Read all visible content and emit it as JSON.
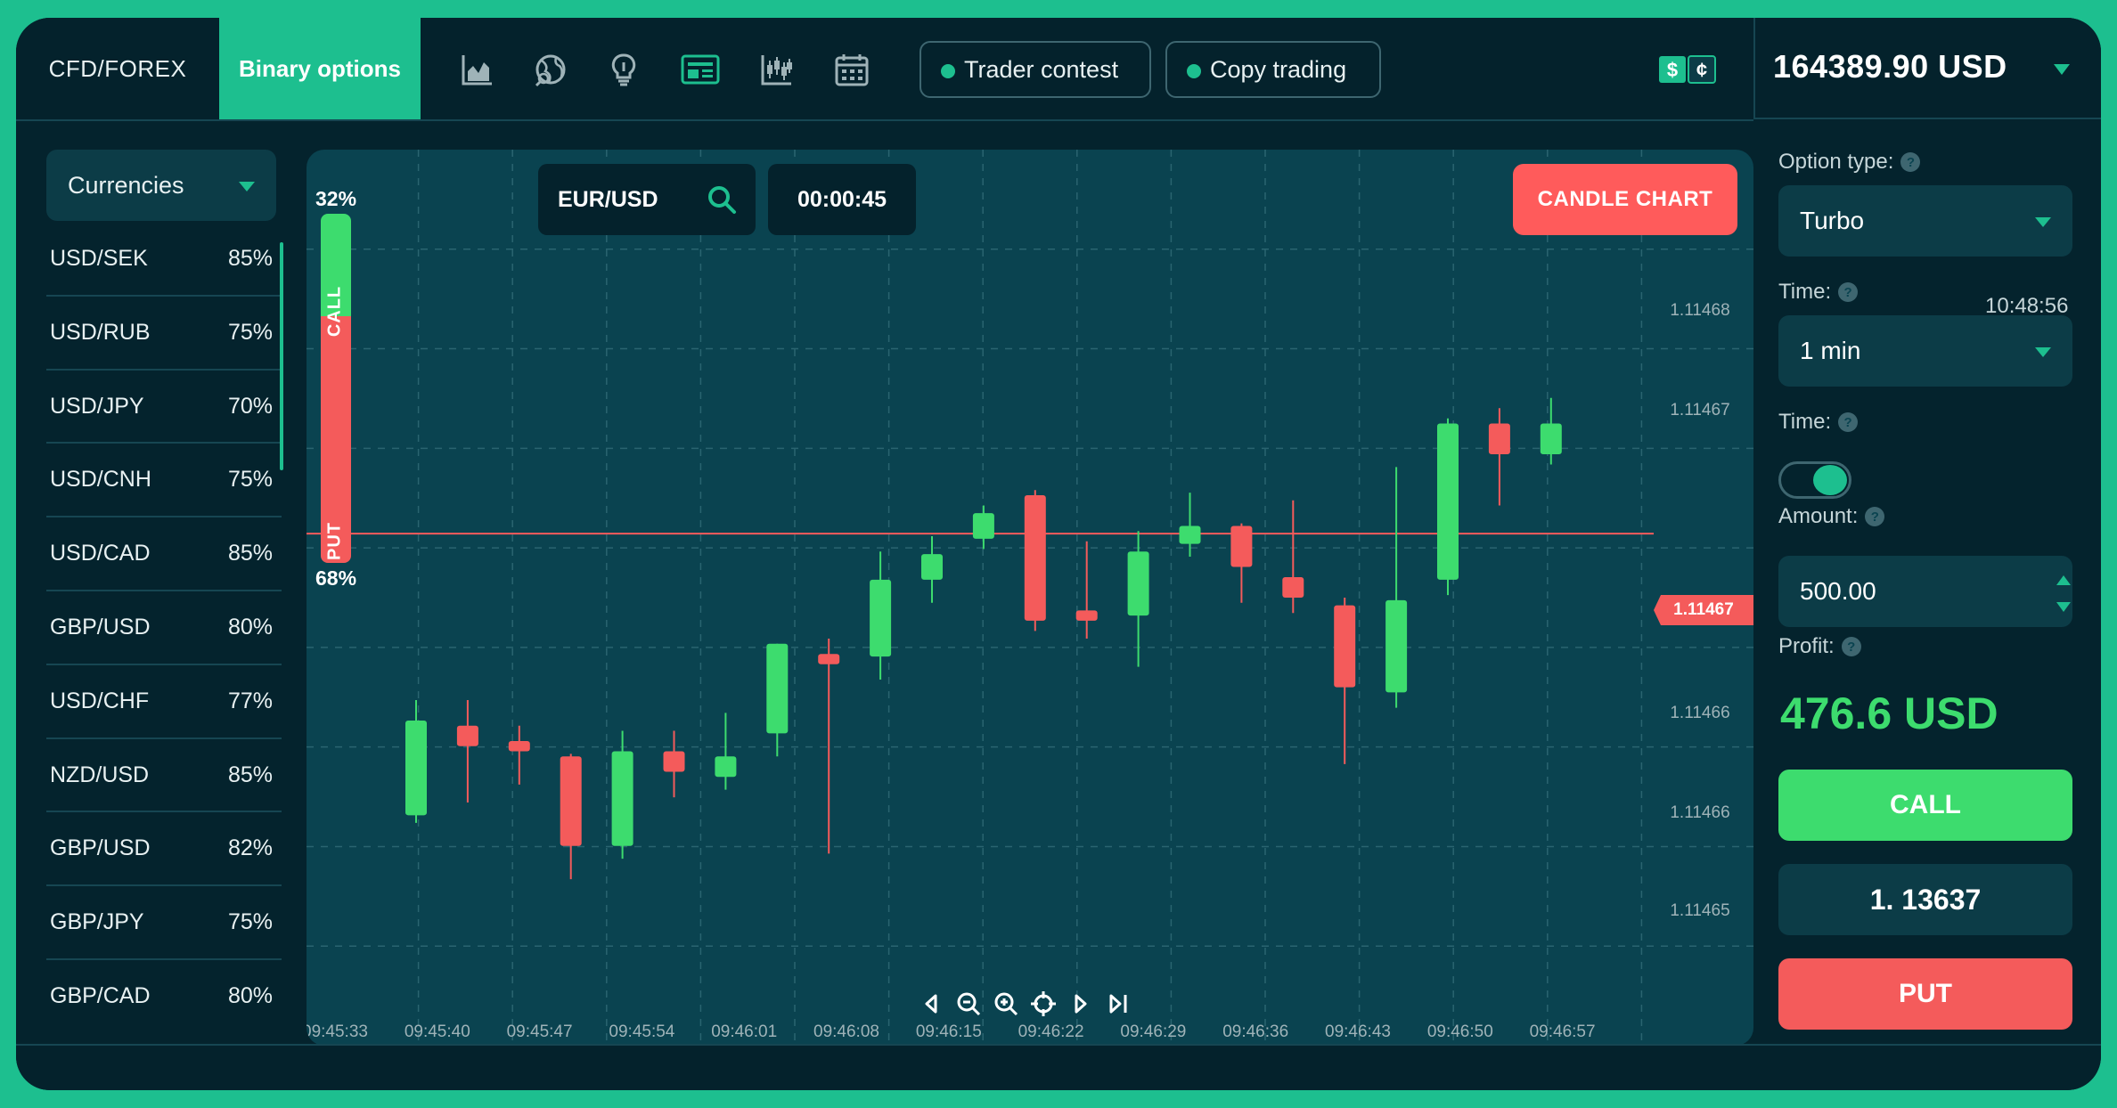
{
  "header": {
    "tabs": [
      {
        "label": "CFD/FOREX",
        "active": false
      },
      {
        "label": "Binary options",
        "active": true
      }
    ],
    "tool_icons": [
      "area-chart-icon",
      "globe-icon",
      "lightbulb-icon",
      "news-icon",
      "candles-icon",
      "calendar-icon"
    ],
    "trader_contest_label": "Trader contest",
    "copy_trading_label": "Copy trading",
    "currency_icon": "dollar-cent-icon",
    "balance": "164389.90 USD"
  },
  "sidebar": {
    "category_label": "Currencies",
    "pairs": [
      {
        "name": "USD/SEK",
        "payout": "85%"
      },
      {
        "name": "USD/RUB",
        "payout": "75%"
      },
      {
        "name": "USD/JPY",
        "payout": "70%"
      },
      {
        "name": "USD/CNH",
        "payout": "75%"
      },
      {
        "name": "USD/CAD",
        "payout": "85%"
      },
      {
        "name": "GBP/USD",
        "payout": "80%"
      },
      {
        "name": "USD/CHF",
        "payout": "77%"
      },
      {
        "name": "NZD/USD",
        "payout": "85%"
      },
      {
        "name": "GBP/USD",
        "payout": "82%"
      },
      {
        "name": "GBP/JPY",
        "payout": "75%"
      },
      {
        "name": "GBP/CAD",
        "payout": "80%"
      }
    ]
  },
  "chart": {
    "pair": "EUR/USD",
    "countdown": "00:00:45",
    "chart_type_button": "CANDLE CHART",
    "sentiment": {
      "call_pct": "32%",
      "put_pct": "68%",
      "call_fraction": 0.32,
      "call_label": "CALL",
      "put_label": "PUT"
    },
    "current_price_label": "1.11467",
    "nav_icons": [
      "step-back-icon",
      "zoom-out-icon",
      "zoom-in-icon",
      "crosshair-icon",
      "step-forward-icon",
      "skip-end-icon"
    ],
    "colors": {
      "up": "#3ddc6e",
      "down": "#f45b5b"
    }
  },
  "chart_data": {
    "type": "candlestick",
    "x_tick_labels": [
      "09:45:33",
      "09:45:40",
      "09:45:47",
      "09:45:54",
      "09:46:01",
      "09:46:08",
      "09:46:15",
      "09:46:22",
      "09:46:29",
      "09:46:36",
      "09:46:43",
      "09:46:50",
      "09:46:57"
    ],
    "y_tick_labels": [
      "1.11468",
      "1.11468",
      "1.11467",
      "1.11467",
      "1.11466",
      "1.11466",
      "1.11465"
    ],
    "ylim": [
      1.11465,
      1.114685
    ],
    "current_price": 1.11467,
    "grid": true,
    "candles": [
      {
        "open": 1.114659,
        "high": 1.1146635,
        "low": 1.1146587,
        "close": 1.1146627
      },
      {
        "open": 1.1146625,
        "high": 1.1146635,
        "low": 1.1146595,
        "close": 1.1146617
      },
      {
        "open": 1.1146619,
        "high": 1.1146625,
        "low": 1.1146602,
        "close": 1.1146615
      },
      {
        "open": 1.1146613,
        "high": 1.1146614,
        "low": 1.1146565,
        "close": 1.1146578
      },
      {
        "open": 1.1146578,
        "high": 1.1146623,
        "low": 1.1146573,
        "close": 1.1146615
      },
      {
        "open": 1.1146615,
        "high": 1.1146623,
        "low": 1.1146597,
        "close": 1.1146607
      },
      {
        "open": 1.1146605,
        "high": 1.114663,
        "low": 1.11466,
        "close": 1.1146613
      },
      {
        "open": 1.1146622,
        "high": 1.1146657,
        "low": 1.1146613,
        "close": 1.1146657
      },
      {
        "open": 1.1146653,
        "high": 1.1146659,
        "low": 1.1146575,
        "close": 1.1146649
      },
      {
        "open": 1.1146652,
        "high": 1.1146693,
        "low": 1.1146643,
        "close": 1.1146682
      },
      {
        "open": 1.1146682,
        "high": 1.1146699,
        "low": 1.1146673,
        "close": 1.1146692
      },
      {
        "open": 1.1146698,
        "high": 1.1146711,
        "low": 1.1146694,
        "close": 1.1146708
      },
      {
        "open": 1.1146715,
        "high": 1.1146717,
        "low": 1.1146662,
        "close": 1.1146666
      },
      {
        "open": 1.114667,
        "high": 1.1146697,
        "low": 1.1146659,
        "close": 1.1146666
      },
      {
        "open": 1.1146668,
        "high": 1.1146701,
        "low": 1.1146648,
        "close": 1.1146693
      },
      {
        "open": 1.1146696,
        "high": 1.1146716,
        "low": 1.1146691,
        "close": 1.1146703
      },
      {
        "open": 1.1146703,
        "high": 1.1146704,
        "low": 1.1146673,
        "close": 1.1146687
      },
      {
        "open": 1.1146683,
        "high": 1.1146713,
        "low": 1.1146669,
        "close": 1.1146675
      },
      {
        "open": 1.1146672,
        "high": 1.1146675,
        "low": 1.114661,
        "close": 1.114664
      },
      {
        "open": 1.1146638,
        "high": 1.1146726,
        "low": 1.1146632,
        "close": 1.1146674
      },
      {
        "open": 1.1146682,
        "high": 1.1146745,
        "low": 1.1146676,
        "close": 1.1146743
      },
      {
        "open": 1.1146743,
        "high": 1.1146749,
        "low": 1.1146711,
        "close": 1.1146731
      },
      {
        "open": 1.1146731,
        "high": 1.1146753,
        "low": 1.1146727,
        "close": 1.1146743
      }
    ]
  },
  "order_panel": {
    "option_type_label": "Option type:",
    "option_type_value": "Turbo",
    "time_label": "Time:",
    "clock": "10:48:56",
    "time_value": "1 min",
    "time_toggle_label": "Time:",
    "toggle_on": true,
    "amount_label": "Amount:",
    "amount_value": "500.00",
    "profit_label": "Profit:",
    "profit_value": "476.6 USD",
    "call_label": "CALL",
    "rate": "1. 13637",
    "put_label": "PUT",
    "help_glyph": "?"
  }
}
